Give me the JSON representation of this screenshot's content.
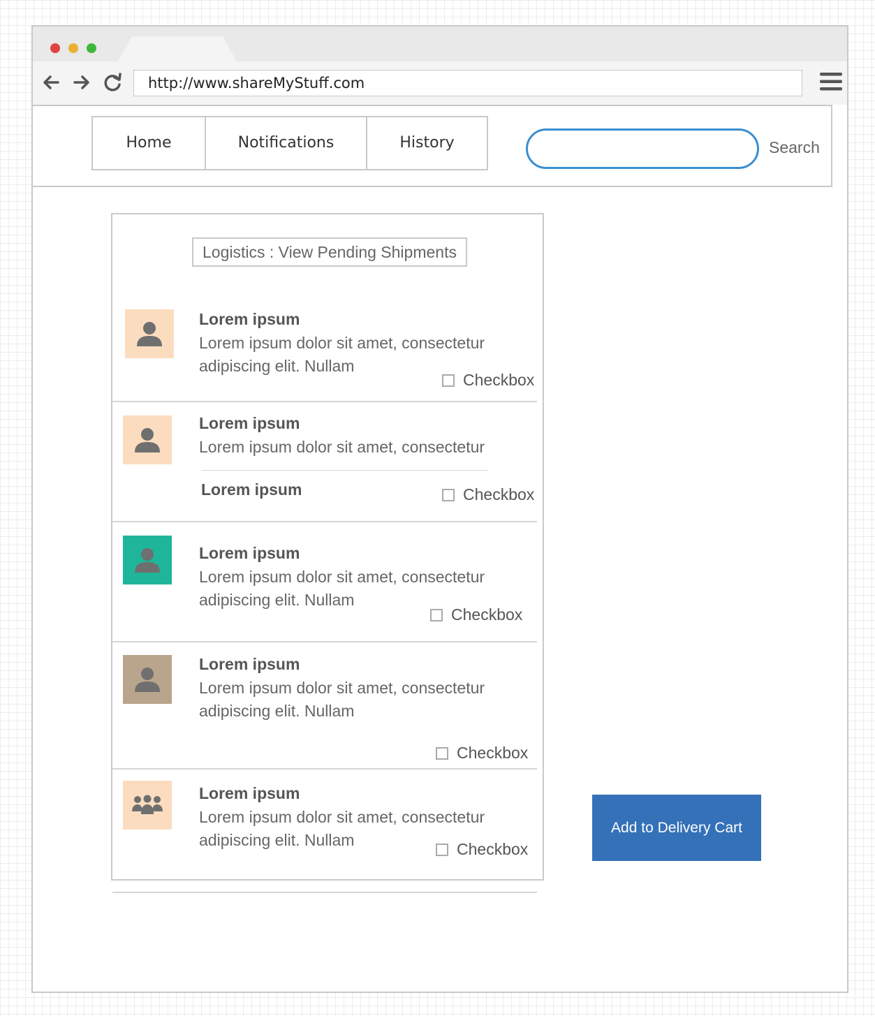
{
  "browser": {
    "url": "http://www.shareMyStuff.com",
    "window_dots": [
      "#e0443e",
      "#e9b130",
      "#3fb73a"
    ]
  },
  "nav": {
    "tabs": [
      "Home",
      "Notifications",
      "History"
    ],
    "search_label": "Search"
  },
  "panel": {
    "title": "Logistics : View Pending Shipments",
    "items": [
      {
        "title": "Lorem ipsum",
        "text": "Lorem ipsum dolor sit amet, consectetur adipiscing elit. Nullam",
        "checkbox_label": "Checkbox",
        "checked": false,
        "avatar_color": "#fcdcbf",
        "icon": "person-icon"
      },
      {
        "title": "Lorem ipsum",
        "text": "Lorem ipsum dolor sit amet, consectetur",
        "subtitle": "Lorem ipsum",
        "checkbox_label": "Checkbox",
        "checked": false,
        "avatar_color": "#fcdcbf",
        "icon": "person-icon"
      },
      {
        "title": "Lorem ipsum",
        "text": "Lorem ipsum dolor sit amet, consectetur adipiscing elit. Nullam",
        "checkbox_label": "Checkbox",
        "checked": false,
        "avatar_color": "#1fb59a",
        "icon": "person-icon"
      },
      {
        "title": "Lorem ipsum",
        "text": "Lorem ipsum dolor sit amet, consectetur adipiscing elit. Nullam",
        "checkbox_label": "Checkbox",
        "checked": false,
        "avatar_color": "#b8a58c",
        "icon": "person-icon"
      },
      {
        "title": "Lorem ipsum",
        "text": "Lorem ipsum dolor sit amet, consectetur adipiscing elit. Nullam",
        "checkbox_label": "Checkbox",
        "checked": false,
        "avatar_color": "#fcdcbf",
        "icon": "group-icon"
      }
    ]
  },
  "actions": {
    "add_to_cart_label": "Add to Delivery Cart",
    "button_color": "#3571b8"
  }
}
